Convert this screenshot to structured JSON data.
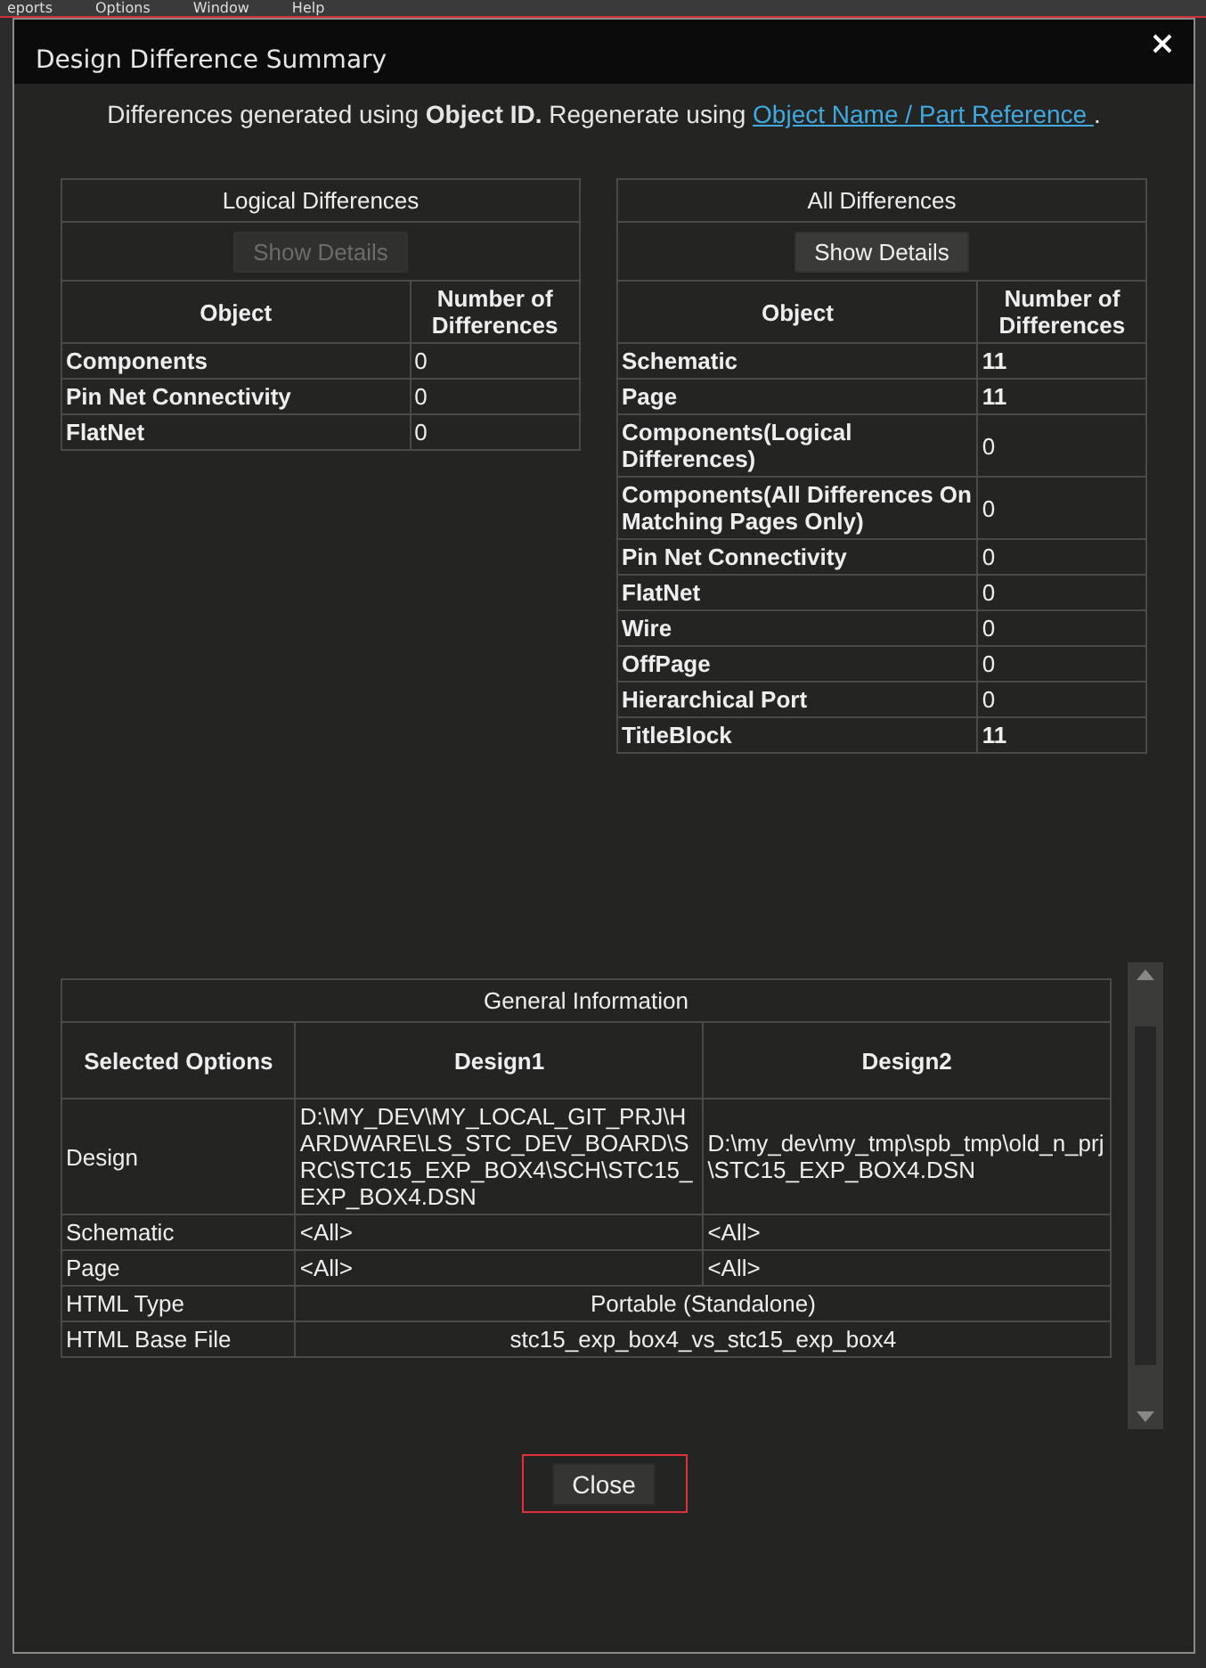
{
  "menu_bar": [
    "eports",
    "Options",
    "Window",
    "Help"
  ],
  "dialog": {
    "title": "Design Difference Summary"
  },
  "intro": {
    "text": "Differences generated using **Object ID.** Regenerate using ",
    "link": "Object Name / Part Reference ",
    "tail": "."
  },
  "logical_differences": {
    "title": "Logical Differences",
    "show_details": {
      "label": "Show Details",
      "disabled": true
    },
    "columns": [
      "Object",
      "Number of Differences"
    ],
    "rows": [
      {
        "object": "Components",
        "count": "0"
      },
      {
        "object": "Pin Net Connectivity",
        "count": "0"
      },
      {
        "object": "FlatNet",
        "count": "0"
      }
    ]
  },
  "all_differences": {
    "title": "All Differences",
    "show_details": {
      "label": "Show Details",
      "disabled": false
    },
    "columns": [
      "Object",
      "Number of Differences"
    ],
    "rows": [
      {
        "object": "Schematic",
        "count": "11"
      },
      {
        "object": "Page",
        "count": "11"
      },
      {
        "object": "Components(Logical Differences)",
        "count": "0"
      },
      {
        "object": "Components(All Differences On Matching Pages Only)",
        "count": "0"
      },
      {
        "object": "Pin Net Connectivity",
        "count": "0"
      },
      {
        "object": "FlatNet",
        "count": "0"
      },
      {
        "object": "Wire",
        "count": "0"
      },
      {
        "object": "OffPage",
        "count": "0"
      },
      {
        "object": "Hierarchical Port",
        "count": "0"
      },
      {
        "object": "TitleBlock",
        "count": "11"
      }
    ]
  },
  "general_information": {
    "title": "General Information",
    "columns": [
      "Selected Options",
      "Design1",
      "Design2"
    ],
    "rows": [
      {
        "cells": [
          "Design",
          "D:\\MY_DEV\\MY_LOCAL_GIT_PRJ\\HARDWARE\\LS_STC_DEV_BOARD\\SRC\\STC15_EXP_BOX4\\SCH\\STC15_EXP_BOX4.DSN",
          "D:\\my_dev\\my_tmp\\spb_tmp\\old_n_prj\\STC15_EXP_BOX4.DSN"
        ]
      },
      {
        "cells": [
          "Schematic",
          "<All>",
          "<All>"
        ]
      },
      {
        "cells": [
          "Page",
          "<All>",
          "<All>"
        ]
      },
      {
        "cells": [
          "HTML Type",
          {
            "text": "Portable (Standalone)",
            "colspan": 2
          }
        ]
      },
      {
        "cells": [
          "HTML Base File",
          {
            "text": "stc15_exp_box4_vs_stc15_exp_box4",
            "colspan": 2
          }
        ]
      }
    ]
  },
  "close_button": "Close"
}
